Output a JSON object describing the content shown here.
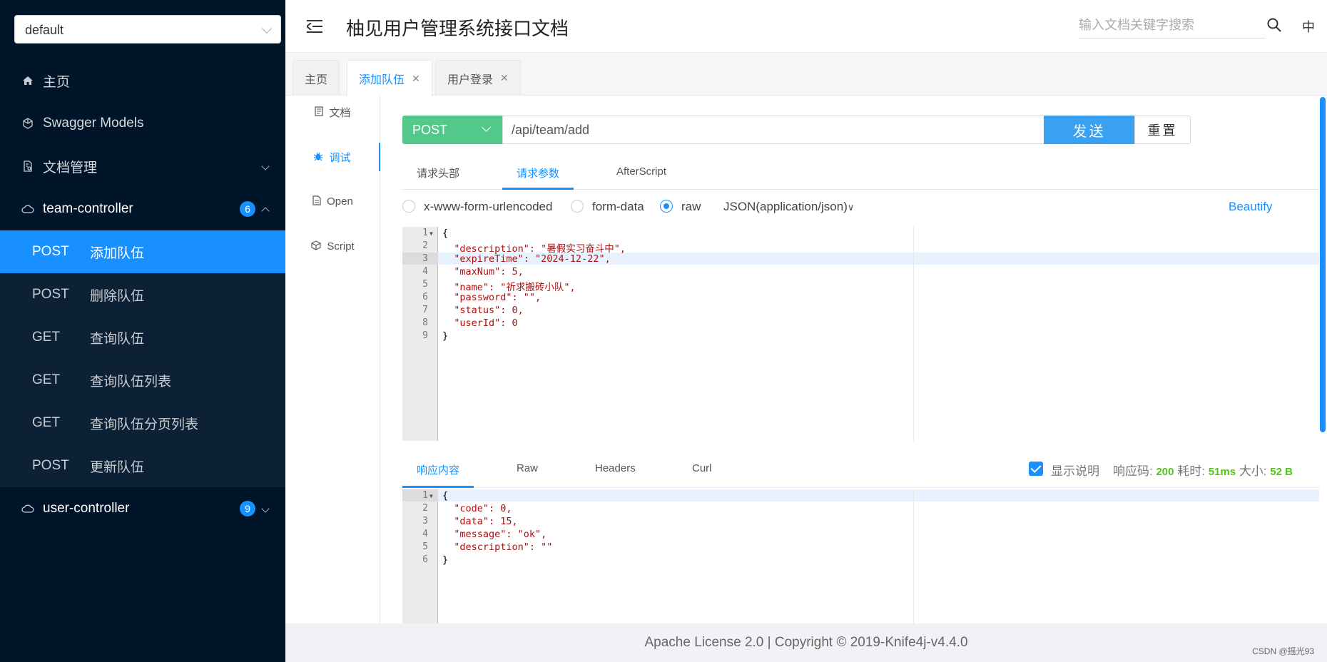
{
  "sidebar": {
    "group_select": "default",
    "menu": [
      {
        "label": "主页"
      },
      {
        "label": "Swagger Models"
      },
      {
        "label": "文档管理"
      }
    ],
    "team_controller": {
      "label": "team-controller",
      "count": "6"
    },
    "team_items": [
      {
        "method": "POST",
        "title": "添加队伍"
      },
      {
        "method": "POST",
        "title": "删除队伍"
      },
      {
        "method": "GET",
        "title": "查询队伍"
      },
      {
        "method": "GET",
        "title": "查询队伍列表"
      },
      {
        "method": "GET",
        "title": "查询队伍分页列表"
      },
      {
        "method": "POST",
        "title": "更新队伍"
      }
    ],
    "user_controller": {
      "label": "user-controller",
      "count": "9"
    }
  },
  "header": {
    "title": "柚见用户管理系统接口文档",
    "search_placeholder": "输入文档关键字搜索",
    "lang": "中"
  },
  "tabs": [
    {
      "label": "主页"
    },
    {
      "label": "添加队伍"
    },
    {
      "label": "用户登录"
    }
  ],
  "docnav": [
    {
      "label": "文档"
    },
    {
      "label": "调试"
    },
    {
      "label": "Open"
    },
    {
      "label": "Script"
    }
  ],
  "request": {
    "method": "POST",
    "url": "/api/team/add",
    "send_label": "发送",
    "reset_label": "重置",
    "subtabs": [
      "请求头部",
      "请求参数",
      "AfterScript"
    ],
    "body_types": [
      "x-www-form-urlencoded",
      "form-data",
      "raw"
    ],
    "content_type": "JSON(application/json)",
    "beautify_label": "Beautify",
    "body_lines": [
      "{",
      "  \"description\": \"暑假实习奋斗中\",",
      "  \"expireTime\": \"2024-12-22\",",
      "  \"maxNum\": 5,",
      "  \"name\": \"祈求搬砖小队\",",
      "  \"password\": \"\",",
      "  \"status\": 0,",
      "  \"userId\": 0",
      "}"
    ]
  },
  "response": {
    "tabs": [
      "响应内容",
      "Raw",
      "Headers",
      "Curl"
    ],
    "show_desc_label": "显示说明",
    "code_label": "响应码:",
    "code": "200",
    "time_label": "耗时:",
    "time": "51ms",
    "size_label": "大小:",
    "size": "52 B",
    "body_lines": [
      "{",
      "  \"code\": 0,",
      "  \"data\": 15,",
      "  \"message\": \"ok\",",
      "  \"description\": \"\"",
      "}"
    ]
  },
  "footer": {
    "text": "Apache License 2.0 | Copyright © 2019-Knife4j-v4.4.0"
  },
  "watermark": "CSDN @摇光93",
  "colors": {
    "sidebar_bg": "#001529",
    "accent": "#1890ff",
    "post_green": "#52c98b"
  }
}
